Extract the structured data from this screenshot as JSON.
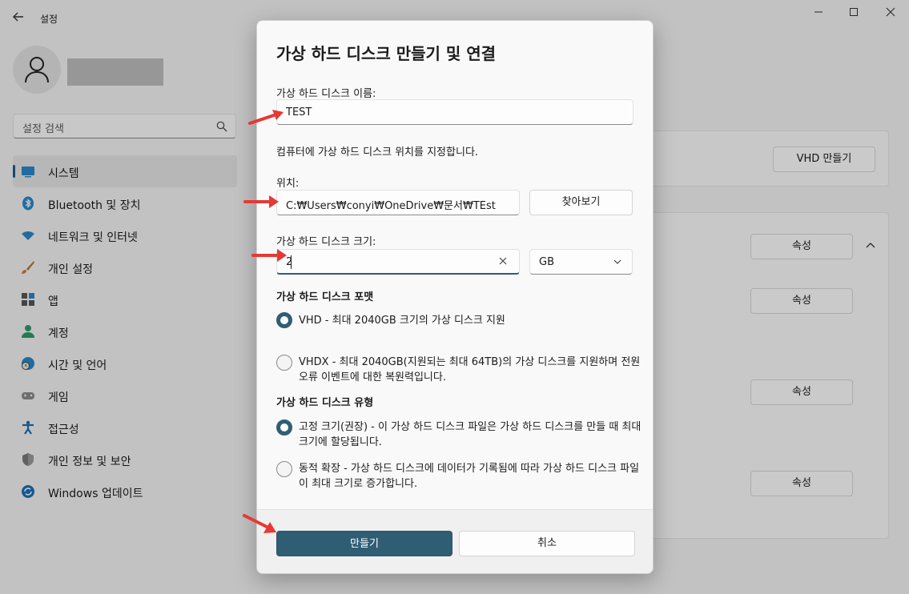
{
  "app": {
    "title": "설정",
    "back_icon": "arrow-left-icon",
    "window_controls": [
      "minimize-icon",
      "maximize-icon",
      "close-icon"
    ]
  },
  "search": {
    "placeholder": "설정 검색",
    "icon": "search-icon"
  },
  "sidebar": {
    "items": [
      {
        "label": "시스템",
        "icon": "display-icon",
        "active": true
      },
      {
        "label": "Bluetooth 및 장치",
        "icon": "bluetooth-icon"
      },
      {
        "label": "네트워크 및 인터넷",
        "icon": "wifi-icon"
      },
      {
        "label": "개인 설정",
        "icon": "brush-icon"
      },
      {
        "label": "앱",
        "icon": "apps-icon"
      },
      {
        "label": "계정",
        "icon": "person-icon"
      },
      {
        "label": "시간 및 언어",
        "icon": "globe-clock-icon"
      },
      {
        "label": "게임",
        "icon": "gamepad-icon"
      },
      {
        "label": "접근성",
        "icon": "accessibility-icon"
      },
      {
        "label": "개인 정보 및 보안",
        "icon": "shield-icon"
      },
      {
        "label": "Windows 업데이트",
        "icon": "update-icon"
      }
    ]
  },
  "background": {
    "vhd_button": "VHD 만들기",
    "properties_label": "속성"
  },
  "dialog": {
    "title": "가상 하드 디스크 만들기 및 연결",
    "name_label": "가상 하드 디스크 이름:",
    "name_value": "TEST",
    "location_hint": "컴퓨터에 가상 하드 디스크 위치를 지정합니다.",
    "location_label": "위치:",
    "location_value": "C:₩Users₩conyi₩OneDrive₩문서₩TEst",
    "browse_button": "찾아보기",
    "size_label": "가상 하드 디스크 크기:",
    "size_value": "2",
    "size_unit": "GB",
    "format_heading": "가상 하드 디스크 포맷",
    "format_options": [
      {
        "text": "VHD - 최대 2040GB 크기의 가상 디스크 지원",
        "selected": true
      },
      {
        "text": "VHDX - 최대 2040GB(지원되는 최대 64TB)의 가상 디스크를 지원하며 전원 오류 이벤트에 대한 복원력입니다.",
        "selected": false
      }
    ],
    "type_heading": "가상 하드 디스크 유형",
    "type_options": [
      {
        "text": "고정 크기(권장) - 이 가상 하드 디스크 파일은 가상 하드 디스크를 만들 때 최대 크기에 할당됩니다.",
        "selected": true
      },
      {
        "text": "동적 확장 - 가상 하드 디스크에 데이터가 기록됨에 따라 가상 하드 디스크 파일이 최대 크기로 증가합니다.",
        "selected": false
      }
    ],
    "create_button": "만들기",
    "cancel_button": "취소"
  },
  "colors": {
    "accent": "#2f5e74",
    "annotation_arrow": "#e53935"
  }
}
